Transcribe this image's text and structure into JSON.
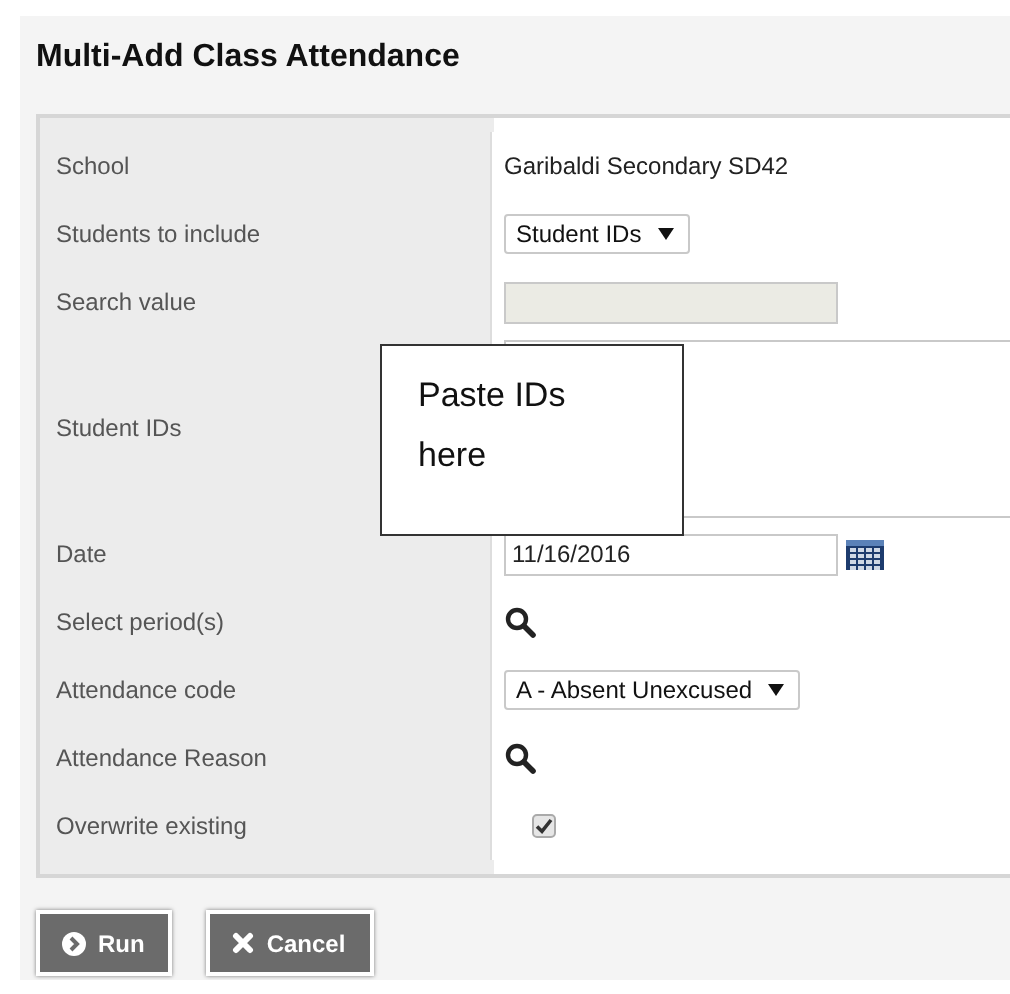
{
  "title": "Multi-Add Class Attendance",
  "rows": [
    {
      "label": "School",
      "kind": "text",
      "value": "Garibaldi Secondary SD42"
    },
    {
      "label": "Students to include",
      "kind": "select",
      "value": "Student IDs"
    },
    {
      "label": "Search value",
      "kind": "field",
      "disabled": true
    },
    {
      "label": "Student IDs",
      "kind": "textarea"
    },
    {
      "label": "Date",
      "kind": "date",
      "value": "11/16/2016"
    },
    {
      "label": "Select period(s)",
      "kind": "lookup"
    },
    {
      "label": "Attendance code",
      "kind": "select",
      "value": "A - Absent Unexcused"
    },
    {
      "label": "Attendance Reason",
      "kind": "lookup"
    },
    {
      "label": "Overwrite existing",
      "kind": "checkbox",
      "checked": true
    }
  ],
  "callout": {
    "text": "Paste IDs here"
  },
  "buttons": [
    {
      "label": "Run",
      "kind": "run"
    },
    {
      "label": "Cancel",
      "kind": "cancel"
    }
  ]
}
